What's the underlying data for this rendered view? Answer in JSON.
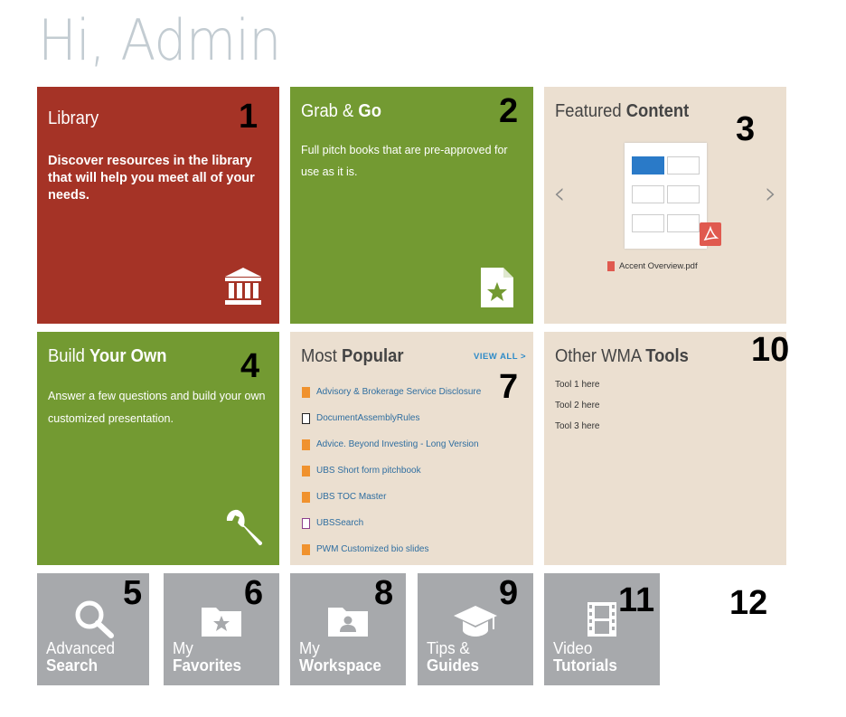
{
  "greeting": "Hi, Admin",
  "tiles": {
    "library": {
      "title": "Library",
      "desc": "Discover resources in the library that will help you meet all of your needs.",
      "number": "1"
    },
    "grab": {
      "title_light": "Grab & ",
      "title_bold": "Go",
      "desc": "Full pitch books that are pre-approved for use as it is.",
      "number": "2"
    },
    "featured": {
      "title_light": "Featured ",
      "title_bold": "Content",
      "file_name": "Accent Overview.pdf",
      "number": "3"
    },
    "build": {
      "title_light": "Build ",
      "title_bold": "Your Own",
      "desc": "Answer a few questions and build your own customized presentation.",
      "number": "4"
    },
    "popular": {
      "title_light": "Most ",
      "title_bold": "Popular",
      "view_all": "VIEW ALL >",
      "number": "7",
      "items": [
        {
          "label": "Advisory & Brokerage Service Disclosure",
          "icon": "orange-doc-icon"
        },
        {
          "label": "DocumentAssemblyRules",
          "icon": "black-doc-icon"
        },
        {
          "label": "Advice. Beyond Investing - Long Version",
          "icon": "orange-doc-icon"
        },
        {
          "label": "UBS Short form pitchbook",
          "icon": "orange-doc-icon"
        },
        {
          "label": "UBS TOC Master",
          "icon": "orange-doc-icon"
        },
        {
          "label": "UBSSearch",
          "icon": "purple-doc-icon"
        },
        {
          "label": "PWM Customized bio slides",
          "icon": "orange-doc-icon"
        }
      ]
    },
    "tools": {
      "title_light": "Other WMA ",
      "title_bold": "Tools",
      "number": "10",
      "items": [
        "Tool 1 here",
        "Tool 2 here",
        "Tool 3 here"
      ]
    },
    "advanced_search": {
      "line1": "Advanced",
      "line2": "Search",
      "number": "5",
      "icon": "search-icon"
    },
    "favorites": {
      "line1": "My",
      "line2": "Favorites",
      "number": "6",
      "icon": "star-folder-icon"
    },
    "workspace": {
      "line1": "My",
      "line2": "Workspace",
      "number": "8",
      "icon": "user-folder-icon"
    },
    "tips": {
      "line1": "Tips &",
      "line2": "Guides",
      "number": "9",
      "icon": "graduation-cap-icon"
    },
    "video": {
      "line1": "Video",
      "line2": "Tutorials",
      "number": "11",
      "icon": "film-icon"
    },
    "empty": {
      "number": "12"
    }
  },
  "colors": {
    "library": "#a53326",
    "green": "#739a32",
    "beige": "#ebdfd0",
    "gray": "#a7a9ac",
    "link": "#2f6ea0",
    "view_all": "#2e8bc8"
  }
}
